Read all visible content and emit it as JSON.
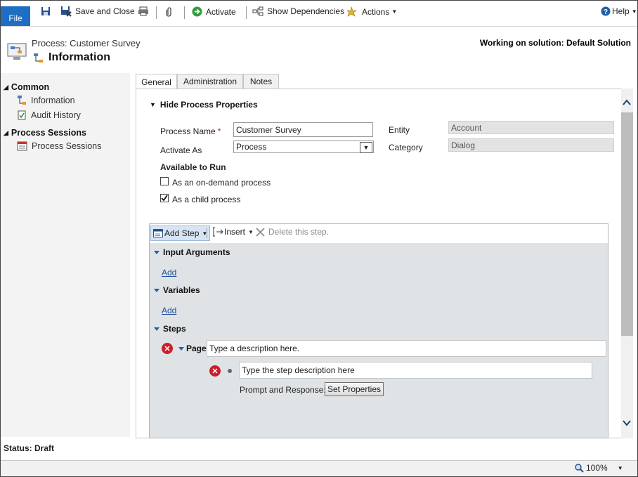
{
  "ribbon": {
    "file": "File",
    "save_and_close": "Save and Close",
    "activate": "Activate",
    "show_dependencies": "Show Dependencies",
    "actions": "Actions",
    "help": "Help"
  },
  "header": {
    "process_title": "Process: Customer Survey",
    "section": "Information",
    "solution": "Working on solution: Default Solution"
  },
  "nav": {
    "common": "Common",
    "information": "Information",
    "audit_history": "Audit History",
    "process_sessions_header": "Process Sessions",
    "process_sessions": "Process Sessions"
  },
  "tabs": [
    "General",
    "Administration",
    "Notes"
  ],
  "form": {
    "section_toggle": "Hide Process Properties",
    "process_name_label": "Process Name",
    "process_name_value": "Customer Survey",
    "activate_as_label": "Activate As",
    "activate_as_value": "Process",
    "entity_label": "Entity",
    "entity_value": "Account",
    "category_label": "Category",
    "category_value": "Dialog",
    "available_to_run": "Available to Run",
    "on_demand_label": "As an on-demand process",
    "on_demand_checked": false,
    "child_label": "As a child process",
    "child_checked": true
  },
  "designer": {
    "add_step": "Add Step",
    "insert": "Insert",
    "delete_step": "Delete this step.",
    "input_arguments": "Input Arguments",
    "add": "Add",
    "variables": "Variables",
    "steps": "Steps",
    "page_label": "Page:",
    "page_placeholder": "Type a description here.",
    "step_placeholder": "Type the step description here",
    "prompt_response_label": "Prompt and Response:",
    "set_properties": "Set Properties"
  },
  "status": "Status: Draft",
  "footer": {
    "zoom": "100%"
  },
  "colors": {
    "file_tab": "#1e6fc4",
    "error": "#c8202a",
    "link": "#1f4f9a"
  }
}
